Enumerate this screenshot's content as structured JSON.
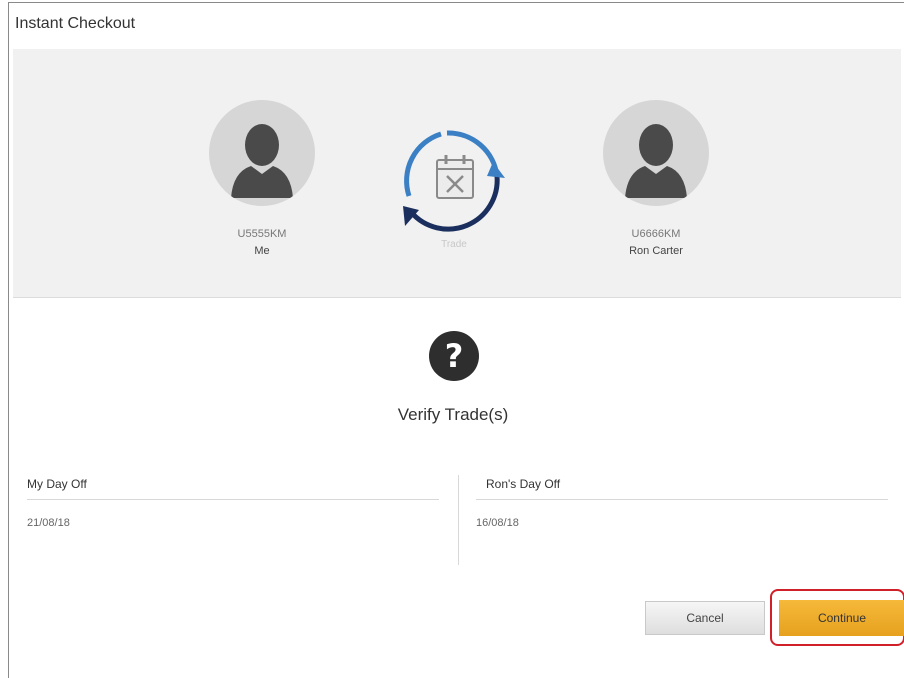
{
  "window": {
    "title": "Instant Checkout"
  },
  "trade_parties": {
    "me": {
      "id": "U5555KM",
      "name": "Me",
      "icon": "user-silhouette-icon"
    },
    "other": {
      "id": "U6666KM",
      "name": "Ron Carter",
      "icon": "user-silhouette-icon"
    },
    "trade": {
      "label": "Trade",
      "icon": "calendar-swap-icon"
    }
  },
  "verify": {
    "icon": "question-mark-icon",
    "heading": "Verify Trade(s)"
  },
  "columns": [
    {
      "header": "My Day Off",
      "value": "21/08/18"
    },
    {
      "header": "Ron's Day Off",
      "value": "16/08/18"
    }
  ],
  "buttons": {
    "cancel": "Cancel",
    "continue": "Continue"
  },
  "colors": {
    "continue_bg": "#f0ae2b",
    "highlight_border": "#d0212a",
    "trade_arrow_light": "#3b7fc4",
    "trade_arrow_dark": "#1b2f5e"
  }
}
